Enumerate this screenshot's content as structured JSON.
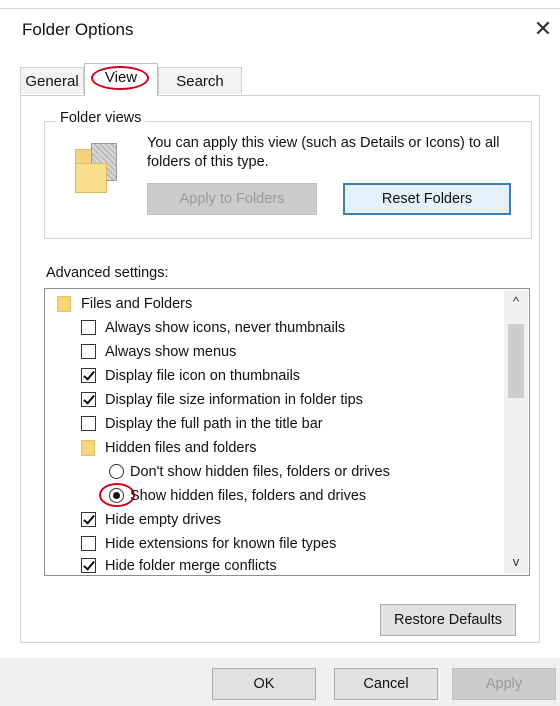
{
  "window": {
    "title": "Folder Options",
    "close_glyph": "✕"
  },
  "tabs": [
    {
      "label": "General",
      "active": false
    },
    {
      "label": "View",
      "active": true,
      "highlighted": true
    },
    {
      "label": "Search",
      "active": false
    }
  ],
  "folder_views": {
    "legend": "Folder views",
    "icon": "folder-views-icon",
    "description": "You can apply this view (such as Details or Icons) to all folders of this type.",
    "apply_button": {
      "label": "Apply to Folders",
      "enabled": false
    },
    "reset_button": {
      "label": "Reset Folders",
      "enabled": true,
      "focused": true
    }
  },
  "advanced": {
    "label": "Advanced settings:",
    "items": [
      {
        "type": "folder",
        "label": "Files and Folders"
      },
      {
        "type": "checkbox",
        "label": "Always show icons, never thumbnails",
        "checked": false
      },
      {
        "type": "checkbox",
        "label": "Always show menus",
        "checked": false
      },
      {
        "type": "checkbox",
        "label": "Display file icon on thumbnails",
        "checked": true
      },
      {
        "type": "checkbox",
        "label": "Display file size information in folder tips",
        "checked": true
      },
      {
        "type": "checkbox",
        "label": "Display the full path in the title bar",
        "checked": false
      },
      {
        "type": "folder",
        "label": "Hidden files and folders"
      },
      {
        "type": "radio",
        "label": "Don't show hidden files, folders or drives",
        "checked": false
      },
      {
        "type": "radio",
        "label": "Show hidden files, folders and drives",
        "checked": true,
        "highlighted": true
      },
      {
        "type": "checkbox",
        "label": "Hide empty drives",
        "checked": true
      },
      {
        "type": "checkbox",
        "label": "Hide extensions for known file types",
        "checked": false
      },
      {
        "type": "checkbox",
        "label": "Hide folder merge conflicts",
        "checked": true
      }
    ],
    "scroll_up_glyph": "^",
    "scroll_down_glyph": "v"
  },
  "restore_defaults": {
    "label": "Restore Defaults"
  },
  "footer": {
    "ok": {
      "label": "OK"
    },
    "cancel": {
      "label": "Cancel"
    },
    "apply": {
      "label": "Apply",
      "enabled": false
    }
  },
  "colors": {
    "highlight_circle": "#d0021b",
    "focus_border": "#3c7fb1",
    "folder_yellow": "#f6d77d"
  }
}
